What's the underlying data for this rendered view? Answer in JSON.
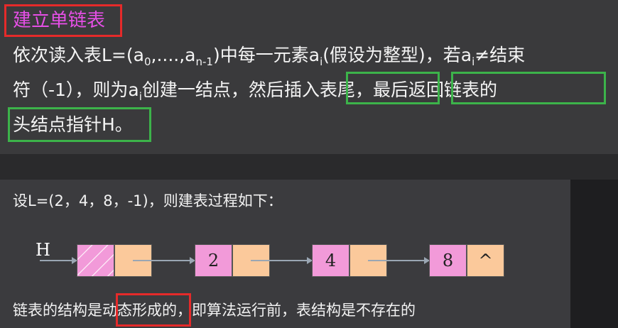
{
  "title": "建立单链表",
  "para": {
    "l1_a": "依次读入表L=(a",
    "l1_sub0": "0",
    "l1_b": ",....,a",
    "l1_sub1": "n-1",
    "l1_c": ")中每一元素a",
    "l1_subi": "i",
    "l1_d": "(假设为整型)，若a",
    "l1_subi2": "i",
    "l1_e": "≠结束",
    "l2_a": "符（-1），则为a",
    "l2_subi": "i",
    "l2_b": "创建一结点，然后",
    "l2_hl1": "插入表尾",
    "l2_c": "，",
    "l2_hl2": "最后返回链表的",
    "l3_hl": "头结点指针H。"
  },
  "example": "设L=(2，4，8，-1)，则建表过程如下：",
  "diagram": {
    "head_label": "H",
    "nodes": [
      "",
      "2",
      "4",
      "8"
    ],
    "last_pointer": "^"
  },
  "footer": {
    "a": "链表的结构是",
    "hl": "动态形成",
    "b": "的，即算法运行前，表结构是不存在的"
  },
  "colors": {
    "title": "#e64fe6",
    "red_box": "#e52a2a",
    "green_box": "#3cb34a",
    "node_data": "#f29ad9",
    "node_pointer": "#fbc99b"
  }
}
